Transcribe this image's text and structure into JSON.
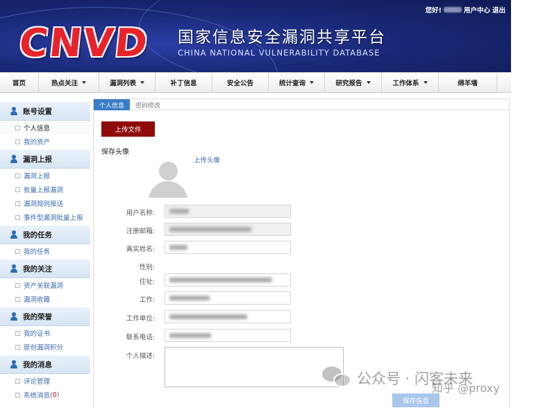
{
  "header": {
    "logo_text": "CNVD",
    "title_cn": "国家信息安全漏洞共享平台",
    "title_en": "CHINA NATIONAL VULNERABILITY DATABASE",
    "greeting": "您好!",
    "user_center": "用户中心",
    "logout": "退出"
  },
  "nav": [
    {
      "label": "首页",
      "dropdown": false
    },
    {
      "label": "热点关注",
      "dropdown": true
    },
    {
      "label": "漏洞列表",
      "dropdown": true
    },
    {
      "label": "补丁信息",
      "dropdown": false
    },
    {
      "label": "安全公告",
      "dropdown": false
    },
    {
      "label": "统计查询",
      "dropdown": true
    },
    {
      "label": "研究报告",
      "dropdown": true
    },
    {
      "label": "工作体系",
      "dropdown": true
    },
    {
      "label": "绵羊墙",
      "dropdown": false
    }
  ],
  "sidebar": {
    "account": {
      "title": "账号设置",
      "items": [
        "个人信息",
        "我的资产"
      ]
    },
    "report": {
      "title": "漏洞上报",
      "items": [
        "漏洞上报",
        "批量上报漏洞",
        "漏洞规则报送",
        "事件型漏洞批量上报"
      ]
    },
    "tasks": {
      "title": "我的任务",
      "items": [
        "我的任务"
      ]
    },
    "follow": {
      "title": "我的关注",
      "items": [
        "资产关联漏洞",
        "漏洞收藏"
      ]
    },
    "honor": {
      "title": "我的荣誉",
      "items": [
        "我的证书",
        "原创漏洞积分"
      ]
    },
    "messages": {
      "title": "我的消息",
      "items": [
        "评论管理",
        "系统消息("
      ],
      "unread": "0",
      "close_paren": ")"
    }
  },
  "tabs": [
    "个人信息",
    "密码修改"
  ],
  "main": {
    "upload_button": "上传文件",
    "save_avatar": "保存头像",
    "upload_avatar": "上传头像",
    "labels": {
      "username": "用户名称:",
      "email": "注册邮箱:",
      "realname": "真实姓名:",
      "gender": "性别:",
      "address": "住址:",
      "job": "工作:",
      "company": "工作单位:",
      "phone": "联系电话:",
      "description": "个人描述:"
    },
    "save_button": "保存信息"
  },
  "watermark": {
    "text1": "公众号 · 闪客未来",
    "text2": "知乎 @proxy"
  },
  "colors": {
    "nav_bg": "#ececec",
    "upload_btn": "#8f0b0b",
    "tab_active": "#3a7cc8",
    "link": "#3a6ab0",
    "save_btn": "#a9c6ec",
    "logo_red": "#e8242a"
  }
}
